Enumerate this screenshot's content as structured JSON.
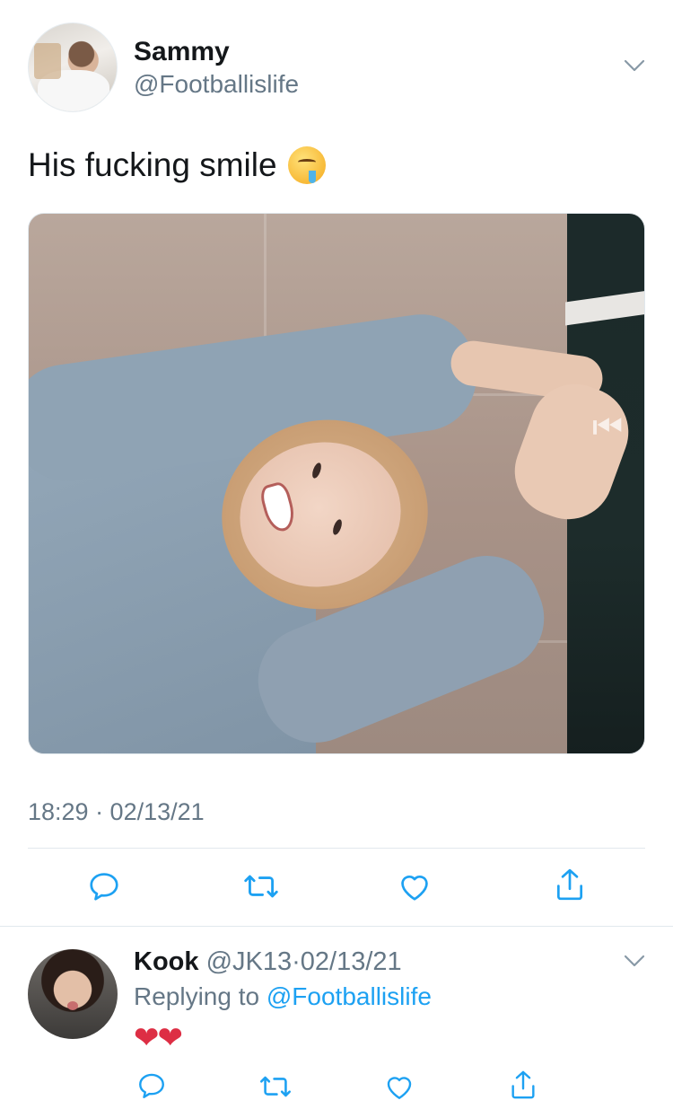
{
  "tweet": {
    "author_name": "Sammy",
    "author_handle": "@Footballislife",
    "text": "His fucking smile",
    "emoji": "drooling-face",
    "timestamp": "18:29 · 02/13/21",
    "media_icon": "rewind-icon"
  },
  "actions": [
    "reply",
    "retweet",
    "like",
    "share"
  ],
  "reply": {
    "author_name": "Kook",
    "author_handle": "@JK13",
    "separator": "·",
    "date": "02/13/21",
    "replying_prefix": "Replying to",
    "replying_to": "@Footballislife",
    "text": "❤❤"
  },
  "colors": {
    "text": "#14171a",
    "muted": "#657786",
    "link": "#1da1f2",
    "divider": "#e1e8ed",
    "heart": "#dd2e44"
  }
}
